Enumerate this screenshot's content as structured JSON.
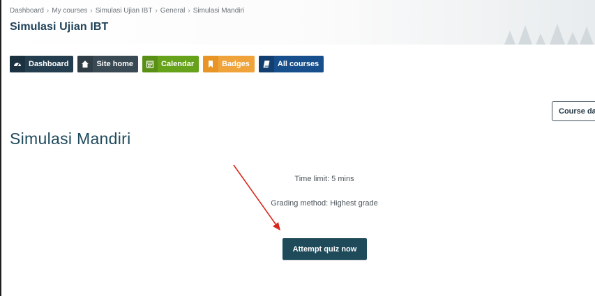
{
  "breadcrumb": {
    "items": [
      "Dashboard",
      "My courses",
      "Simulasi Ujian IBT",
      "General",
      "Simulasi Mandiri"
    ],
    "separator": "›"
  },
  "header": {
    "course_title": "Simulasi Ujian IBT"
  },
  "nav": {
    "buttons": [
      {
        "label": "Dashboard",
        "icon": "dashboard-gauge-icon",
        "color": "#243e4f"
      },
      {
        "label": "Site home",
        "icon": "home-icon",
        "color": "#3a4a54"
      },
      {
        "label": "Calendar",
        "icon": "calendar-icon",
        "color": "#67a21b"
      },
      {
        "label": "Badges",
        "icon": "bookmark-icon",
        "color": "#f0a33a"
      },
      {
        "label": "All courses",
        "icon": "book-icon",
        "color": "#174f8c"
      }
    ]
  },
  "course_dashboard_button": {
    "label": "Course das"
  },
  "main": {
    "title": "Simulasi Mandiri",
    "time_limit": "Time limit: 5 mins",
    "grading_method": "Grading method: Highest grade",
    "attempt_button": "Attempt quiz now"
  },
  "colors": {
    "accent": "#1f4a5a",
    "annotation_arrow": "#d9261c"
  }
}
